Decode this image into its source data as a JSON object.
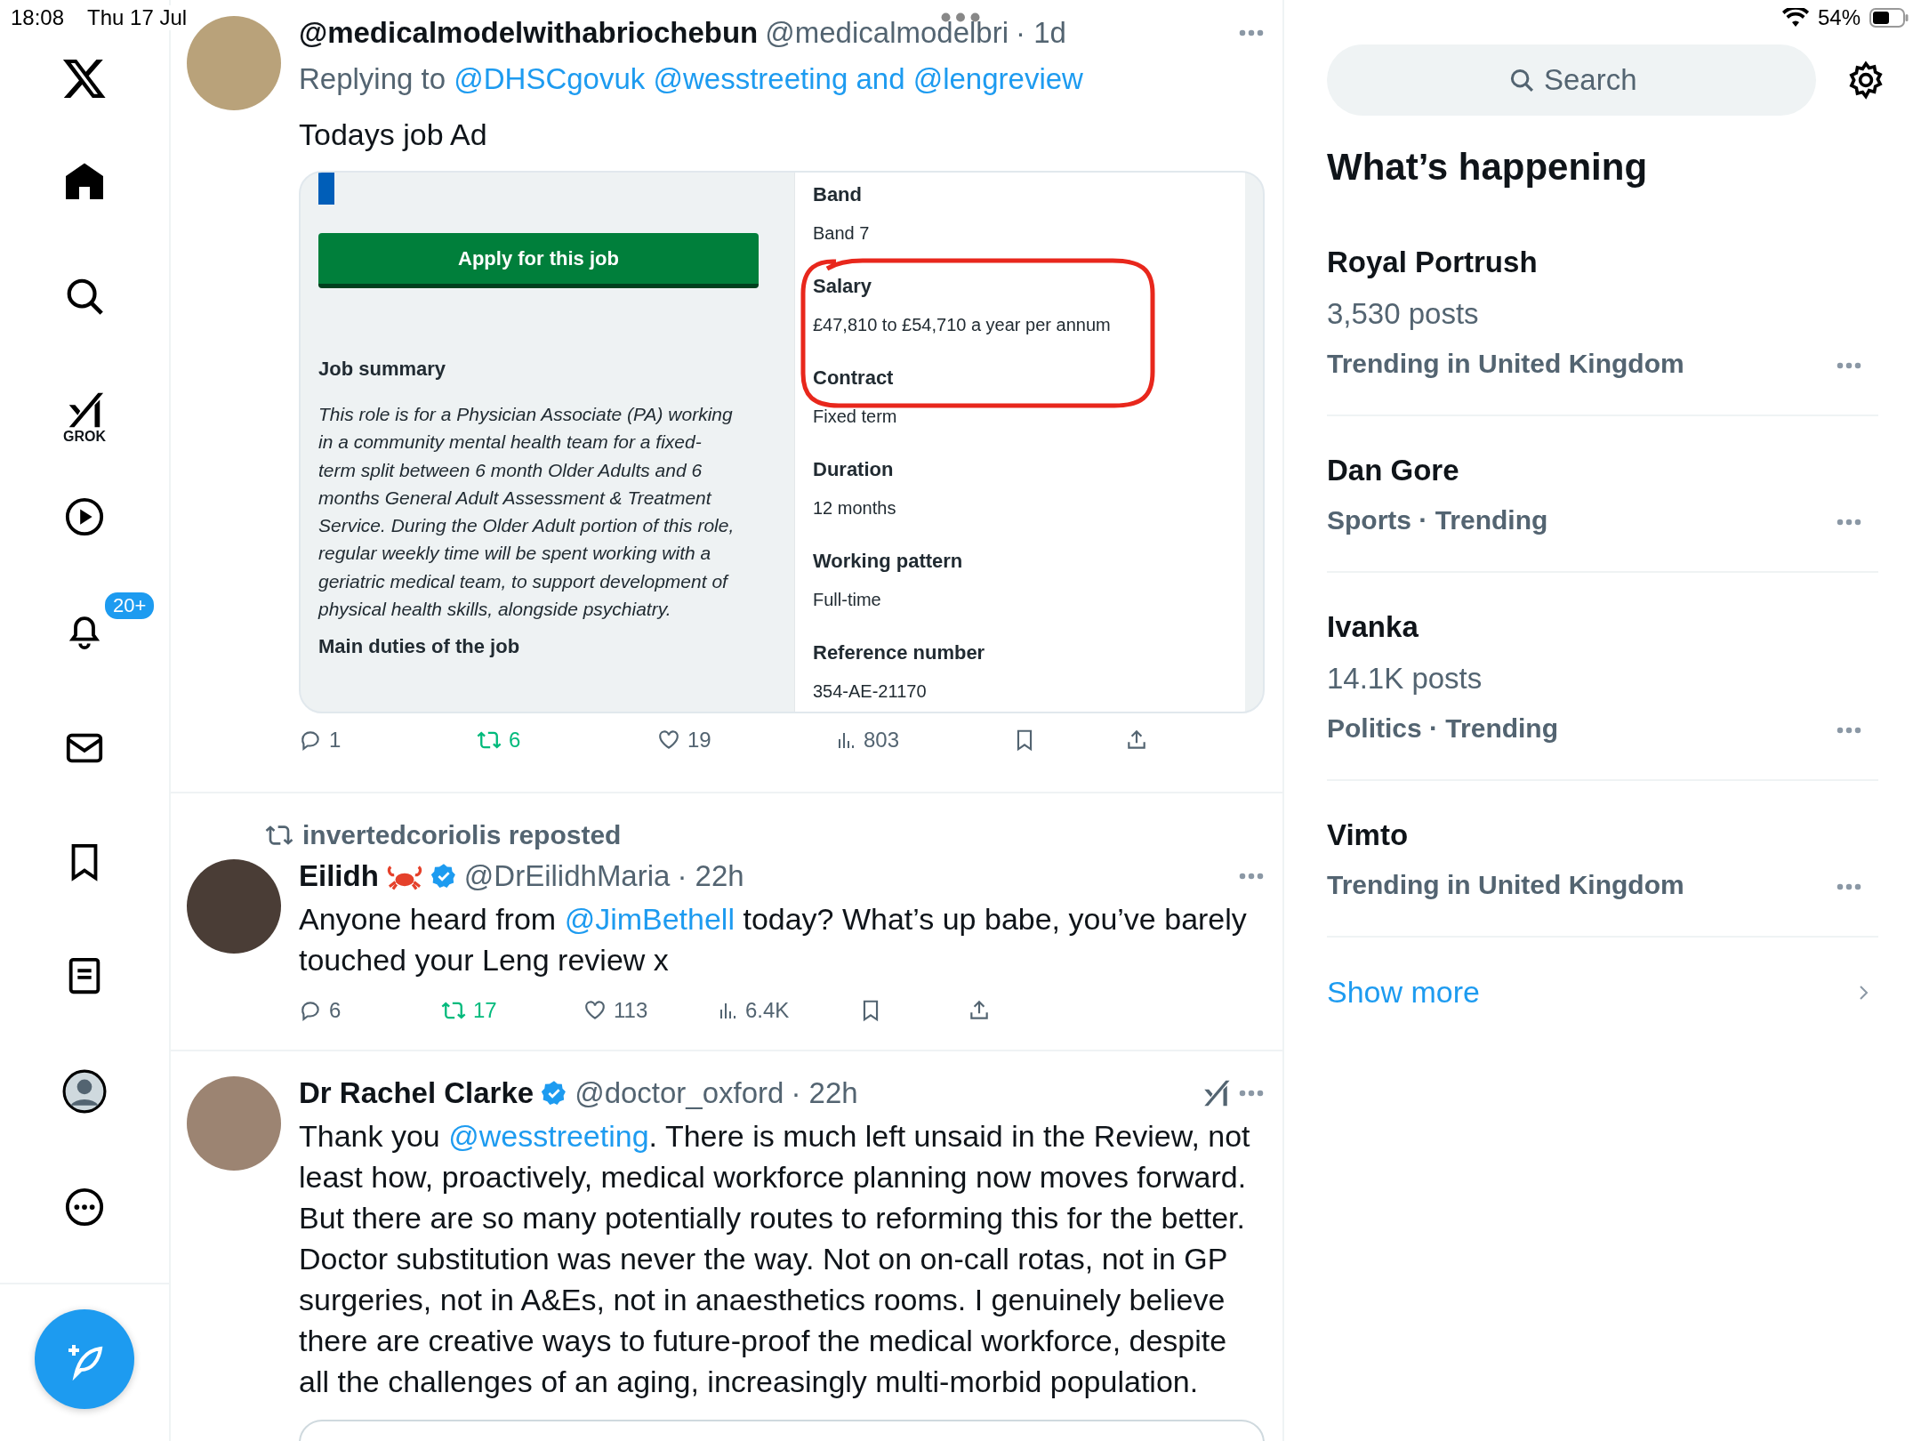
{
  "status_bar": {
    "time": "18:08",
    "date": "Thu 17 Jul",
    "battery": "54%"
  },
  "sidebar": {
    "grok_label": "GROK",
    "notifications_badge": "20+"
  },
  "tweets": [
    {
      "name": "@medicalmodelwithabriochebun",
      "verified": false,
      "handle": "@medicalmodelbri",
      "time": "· 1d",
      "grok_button": false,
      "replying_to": [
        {
          "text": "Replying to ",
          "kind": "plain"
        },
        {
          "text": "@DHSCgovuk @wesstreeting and @lengreview",
          "kind": "mention"
        }
      ],
      "text": [
        {
          "text": "Todays job Ad",
          "kind": "plain"
        }
      ],
      "job_ad": {
        "apply_button": "Apply for this job",
        "summary_heading": "Job summary",
        "summary": "This role is for a Physician Associate (PA) working in a community mental health team for a fixed-term split between 6 month Older Adults and 6 months General Adult Assessment & Treatment Service. During the Older Adult portion of this role, regular weekly time will be spent working with a geriatric medical team, to support development of physical health skills, alongside psychiatry.",
        "duties_heading": "Main duties of the job",
        "fields": [
          {
            "label": "Band",
            "value": "Band 7"
          },
          {
            "label": "Salary",
            "value": "£47,810 to £54,710 a year per annum"
          },
          {
            "label": "Contract",
            "value": "Fixed term"
          },
          {
            "label": "Duration",
            "value": "12 months"
          },
          {
            "label": "Working pattern",
            "value": "Full-time"
          },
          {
            "label": "Reference number",
            "value": "354-AE-21170"
          }
        ]
      },
      "actions": {
        "replies": "1",
        "reposts": "6",
        "likes": "19",
        "views": "803",
        "reposted": true,
        "liked": false
      }
    },
    {
      "reposted_by": "invertedcoriolis reposted",
      "name": "Eilidh",
      "name_badge": {
        "kind": "crab"
      },
      "verified": true,
      "handle": "@DrEilidhMaria",
      "time": "· 22h",
      "grok_button": false,
      "text": [
        {
          "text": "Anyone heard from ",
          "kind": "plain"
        },
        {
          "text": "@JimBethell",
          "kind": "mention"
        },
        {
          "text": " today? What’s up babe, you’ve barely touched your Leng review x",
          "kind": "plain"
        }
      ],
      "actions": {
        "replies": "6",
        "reposts": "17",
        "likes": "113",
        "views": "6.4K",
        "reposted": true,
        "liked": false
      }
    },
    {
      "name": "Dr Rachel Clarke",
      "verified": true,
      "handle": "@doctor_oxford",
      "time": "· 22h",
      "grok_button": true,
      "text": [
        {
          "text": "Thank you ",
          "kind": "plain"
        },
        {
          "text": "@wesstreeting",
          "kind": "mention"
        },
        {
          "text": ". There is much left unsaid in the Review, not least how, proactively, medical workforce planning now moves forward. But there are so many potentially routes to reforming this for the better. Doctor substitution was never the way. Not on on-call rotas, not in GP surgeries, not in A&Es, not in anaesthetics rooms. I genuinely believe there are creative ways to future-proof the medical workforce, despite all the challenges of an aging, increasingly multi-morbid population.",
          "kind": "plain"
        }
      ],
      "link_card": true
    }
  ],
  "search": {
    "placeholder": "Search"
  },
  "trends": {
    "title": "What’s happening",
    "items": [
      {
        "name": "Royal Portrush",
        "posts": "3,530 posts",
        "context": "Trending in United Kingdom"
      },
      {
        "name": "Dan Gore",
        "context": "Sports · Trending"
      },
      {
        "name": "Ivanka",
        "posts": "14.1K posts",
        "context": "Politics · Trending"
      },
      {
        "name": "Vimto",
        "context": "Trending in United Kingdom"
      }
    ],
    "show_more": "Show more"
  }
}
